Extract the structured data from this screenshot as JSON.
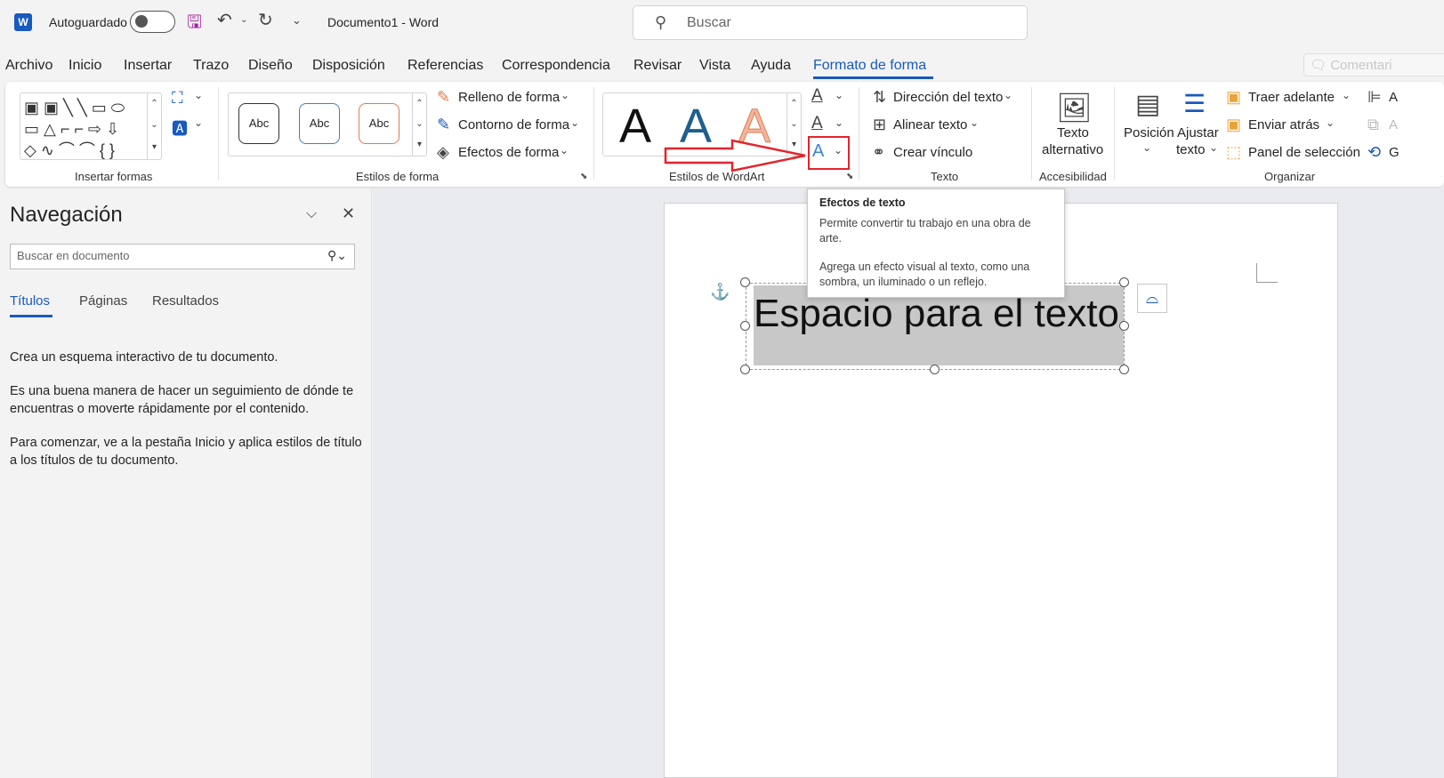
{
  "titlebar": {
    "app_logo": "W",
    "autosave_label": "Autoguardado",
    "doc_title": "Documento1  -  Word",
    "search_placeholder": "Buscar"
  },
  "menu": {
    "tabs": [
      "Archivo",
      "Inicio",
      "Insertar",
      "Trazo",
      "Diseño",
      "Disposición",
      "Referencias",
      "Correspondencia",
      "Revisar",
      "Vista",
      "Ayuda",
      "Formato de forma"
    ],
    "active_tab": "Formato de forma",
    "comments": "Comentari"
  },
  "ribbon": {
    "insertar_formas": {
      "label": "Insertar formas"
    },
    "estilos_forma": {
      "label": "Estilos de forma",
      "sample": "Abc",
      "relleno": "Relleno de forma",
      "contorno": "Contorno de forma",
      "efectos": "Efectos de forma"
    },
    "wordart": {
      "label": "Estilos de WordArt",
      "sample": "A"
    },
    "texto": {
      "label": "Texto",
      "direccion": "Dirección del texto",
      "alinear": "Alinear texto",
      "vinculo": "Crear vínculo"
    },
    "accesibilidad": {
      "label": "Accesibilidad",
      "alt_line1": "Texto",
      "alt_line2": "alternativo"
    },
    "organizar": {
      "label": "Organizar",
      "posicion": "Posición",
      "ajustar_line1": "Ajustar",
      "ajustar_line2": "texto",
      "traer": "Traer adelante",
      "enviar": "Enviar atrás",
      "panel": "Panel de selección",
      "cut_a1": "A",
      "cut_a2": "A",
      "cut_g": "G"
    }
  },
  "tooltip": {
    "title": "Efectos de texto",
    "para1": "Permite convertir tu trabajo en una obra de arte.",
    "para2": "Agrega un efecto visual al texto, como una sombra, un iluminado o un reflejo."
  },
  "navpane": {
    "title": "Navegación",
    "search_placeholder": "Buscar en documento",
    "tabs": [
      "Títulos",
      "Páginas",
      "Resultados"
    ],
    "para1": "Crea un esquema interactivo de tu documento.",
    "para2": "Es una buena manera de hacer un seguimiento de dónde te encuentras o moverte rápidamente por el contenido.",
    "para3": "Para comenzar, ve a la pestaña Inicio y aplica estilos de título a los títulos de tu documento."
  },
  "document": {
    "textbox_text": "Espacio para el texto"
  },
  "colors": {
    "accent": "#185abd",
    "highlight": "#e3242b",
    "textbox_fill": "#c8c8c8"
  }
}
